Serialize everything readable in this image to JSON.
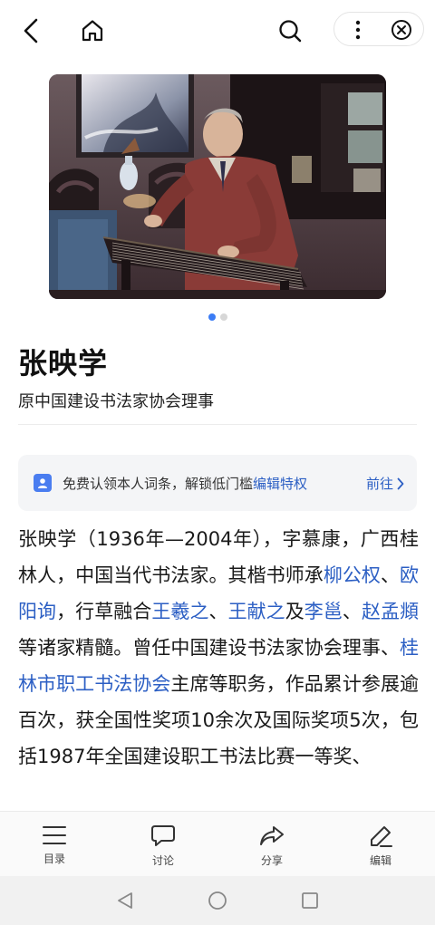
{
  "header": {
    "back_icon": "back-arrow-icon",
    "home_icon": "home-icon",
    "search_icon": "search-icon",
    "more_icon": "more-vertical-icon",
    "close_icon": "close-circle-icon"
  },
  "gallery": {
    "image_alt": "",
    "page_count": 2,
    "active_index": 0,
    "accent": "#3b7cf5"
  },
  "entry": {
    "title": "张映学",
    "subtitle": "原中国建设书法家协会理事"
  },
  "claim_banner": {
    "text": "免费认领本人词条，解锁低门槛",
    "link_text": "编辑特权",
    "action": "前往",
    "icon": "person-card-icon"
  },
  "article": {
    "t1": "张映学（1936年—2004年），字慕康，广西桂林人，中国当代书法家。其楷书师承",
    "l1": "柳公权",
    "t2": "、",
    "l2": "欧阳询",
    "t3": "，行草融合",
    "l3": "王羲之",
    "t4": "、",
    "l4": "王献之",
    "t5": "及",
    "l5": "李邕",
    "t6": "、",
    "l6": "赵孟頫",
    "t7": "等诸家精髓。曾任中国建设书法家协会理事、",
    "l7": "桂林市职工书法协会",
    "t8": "主席等职务，作品累计参展逾百次，获全国性奖项10余次及国际奖项5次，包括1987年全国建设职工书法比赛一等奖、"
  },
  "bottom_nav": [
    {
      "label": "目录",
      "icon": "list-icon"
    },
    {
      "label": "讨论",
      "icon": "chat-bubble-icon"
    },
    {
      "label": "分享",
      "icon": "share-arrow-icon"
    },
    {
      "label": "编辑",
      "icon": "edit-pencil-icon"
    }
  ],
  "system_nav": {
    "back": "triangle-back-icon",
    "home": "circle-home-icon",
    "recents": "square-recents-icon"
  },
  "colors": {
    "link": "#2c5fc4",
    "banner_bg": "#f4f5f7"
  }
}
